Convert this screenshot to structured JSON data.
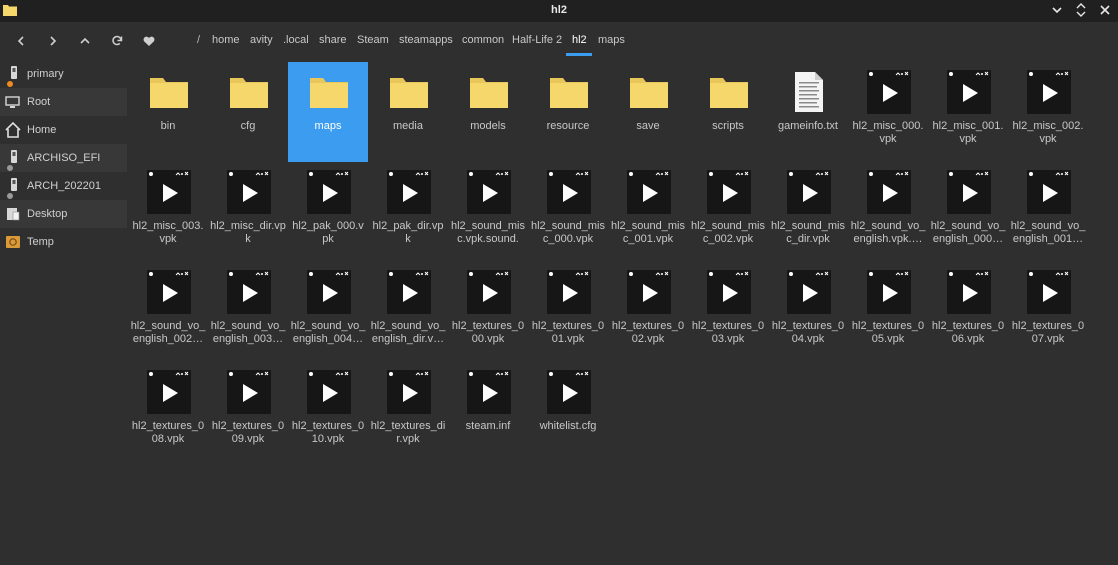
{
  "window": {
    "title": "hl2",
    "folder_color": "#f6d76b",
    "accent": "#3c9cf0"
  },
  "breadcrumb": {
    "separator": "/",
    "items": [
      "home",
      "avity",
      ".local",
      "share",
      "Steam",
      "steamapps",
      "common",
      "Half-Life 2",
      "hl2",
      "maps"
    ],
    "active_index": 8
  },
  "sidebar": {
    "items": [
      {
        "label": "primary",
        "icon": "drive-icon",
        "mounted_dot": "#f08a24"
      },
      {
        "label": "Root",
        "icon": "computer-icon"
      },
      {
        "label": "Home",
        "icon": "home-icon"
      },
      {
        "label": "ARCHISO_EFI",
        "icon": "usb-drive-icon",
        "mounted_dot": "#9a9a9a"
      },
      {
        "label": "ARCH_202201",
        "icon": "usb-drive-icon",
        "mounted_dot": "#9a9a9a"
      },
      {
        "label": "Desktop",
        "icon": "desktop-icon"
      },
      {
        "label": "Temp",
        "icon": "temp-folder-icon"
      }
    ]
  },
  "files": [
    {
      "name": "bin",
      "type": "folder"
    },
    {
      "name": "cfg",
      "type": "folder"
    },
    {
      "name": "maps",
      "type": "folder",
      "selected": true
    },
    {
      "name": "media",
      "type": "folder"
    },
    {
      "name": "models",
      "type": "folder"
    },
    {
      "name": "resource",
      "type": "folder"
    },
    {
      "name": "save",
      "type": "folder"
    },
    {
      "name": "scripts",
      "type": "folder"
    },
    {
      "name": "gameinfo.txt",
      "type": "text"
    },
    {
      "name": "hl2_misc_000.vpk",
      "type": "video"
    },
    {
      "name": "hl2_misc_001.vpk",
      "type": "video"
    },
    {
      "name": "hl2_misc_002.vpk",
      "type": "video"
    },
    {
      "name": "hl2_misc_003.vpk",
      "type": "video"
    },
    {
      "name": "hl2_misc_dir.vpk",
      "type": "video"
    },
    {
      "name": "hl2_pak_000.vpk",
      "type": "video"
    },
    {
      "name": "hl2_pak_dir.vpk",
      "type": "video"
    },
    {
      "name": "hl2_sound_misc.vpk.sound.c…",
      "type": "video"
    },
    {
      "name": "hl2_sound_misc_000.vpk",
      "type": "video"
    },
    {
      "name": "hl2_sound_misc_001.vpk",
      "type": "video"
    },
    {
      "name": "hl2_sound_misc_002.vpk",
      "type": "video"
    },
    {
      "name": "hl2_sound_misc_dir.vpk",
      "type": "video"
    },
    {
      "name": "hl2_sound_vo_english.vpk.…",
      "type": "video"
    },
    {
      "name": "hl2_sound_vo_english_000…",
      "type": "video"
    },
    {
      "name": "hl2_sound_vo_english_001…",
      "type": "video"
    },
    {
      "name": "hl2_sound_vo_english_002…",
      "type": "video"
    },
    {
      "name": "hl2_sound_vo_english_003…",
      "type": "video"
    },
    {
      "name": "hl2_sound_vo_english_004…",
      "type": "video"
    },
    {
      "name": "hl2_sound_vo_english_dir.v…",
      "type": "video"
    },
    {
      "name": "hl2_textures_000.vpk",
      "type": "video"
    },
    {
      "name": "hl2_textures_001.vpk",
      "type": "video"
    },
    {
      "name": "hl2_textures_002.vpk",
      "type": "video"
    },
    {
      "name": "hl2_textures_003.vpk",
      "type": "video"
    },
    {
      "name": "hl2_textures_004.vpk",
      "type": "video"
    },
    {
      "name": "hl2_textures_005.vpk",
      "type": "video"
    },
    {
      "name": "hl2_textures_006.vpk",
      "type": "video"
    },
    {
      "name": "hl2_textures_007.vpk",
      "type": "video"
    },
    {
      "name": "hl2_textures_008.vpk",
      "type": "video"
    },
    {
      "name": "hl2_textures_009.vpk",
      "type": "video"
    },
    {
      "name": "hl2_textures_010.vpk",
      "type": "video"
    },
    {
      "name": "hl2_textures_dir.vpk",
      "type": "video"
    },
    {
      "name": "steam.inf",
      "type": "video"
    },
    {
      "name": "whitelist.cfg",
      "type": "video"
    }
  ]
}
